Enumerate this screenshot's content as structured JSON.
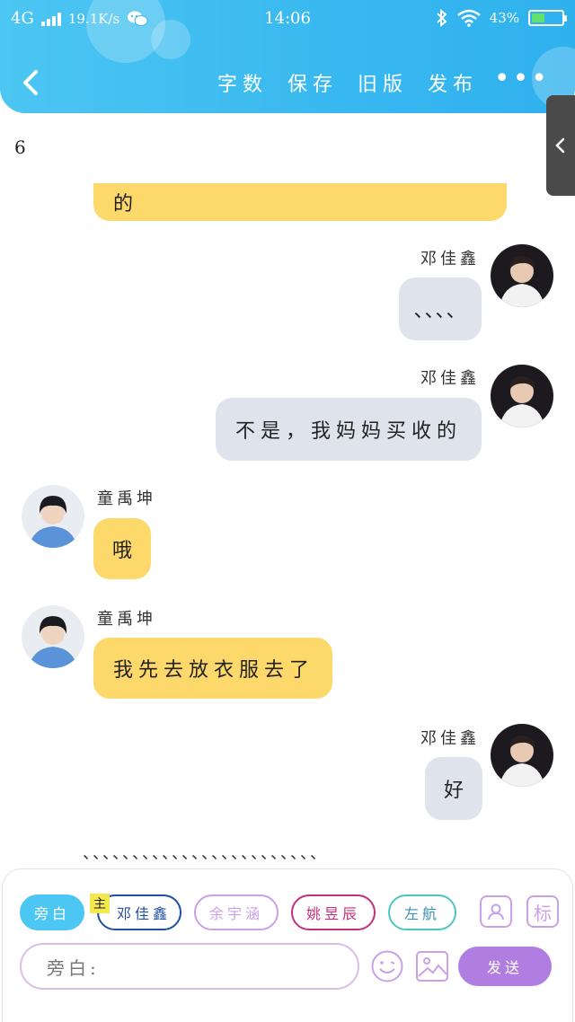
{
  "status_bar": {
    "network": "4G",
    "speed": "19.1K/s",
    "time": "14:06",
    "battery": "43%",
    "battery_level": 0.43
  },
  "nav": {
    "actions": [
      "字数",
      "保存",
      "旧版",
      "发布"
    ],
    "more": "•••"
  },
  "page_number": "6",
  "messages": [
    {
      "id": "m0",
      "speaker": "",
      "text": "的",
      "side": "left",
      "color": "yellow"
    },
    {
      "id": "m1",
      "speaker": "邓佳鑫",
      "text": "、、、、",
      "side": "right",
      "color": "gray"
    },
    {
      "id": "m2",
      "speaker": "邓佳鑫",
      "text": "不是，我妈妈买收的",
      "side": "right",
      "color": "gray"
    },
    {
      "id": "m3",
      "speaker": "童禹坤",
      "text": "哦",
      "side": "left",
      "color": "yellow"
    },
    {
      "id": "m4",
      "speaker": "童禹坤",
      "text": "我先去放衣服去了",
      "side": "left",
      "color": "yellow"
    },
    {
      "id": "m5",
      "speaker": "邓佳鑫",
      "text": "好",
      "side": "right",
      "color": "gray"
    }
  ],
  "ellipsis": "、、、、、、、、、、、、、、、、、、、、、、、、",
  "characters": {
    "tag_main": "主",
    "chips": [
      "旁白",
      "邓佳鑫",
      "余宇涵",
      "姚昱辰",
      "左航"
    ],
    "chip_colors": [
      "#4cc6f2",
      "#1f4f9e",
      "#c9a1e4",
      "#c2307a",
      "#4cc6c0"
    ]
  },
  "input": {
    "placeholder": "旁白:",
    "send_label": "发送",
    "mark_label": "标"
  },
  "colors": {
    "header": "#38b8f0",
    "bubble_yellow": "#fdd86a",
    "bubble_gray": "#dfe4ec",
    "send": "#b07ee0"
  }
}
